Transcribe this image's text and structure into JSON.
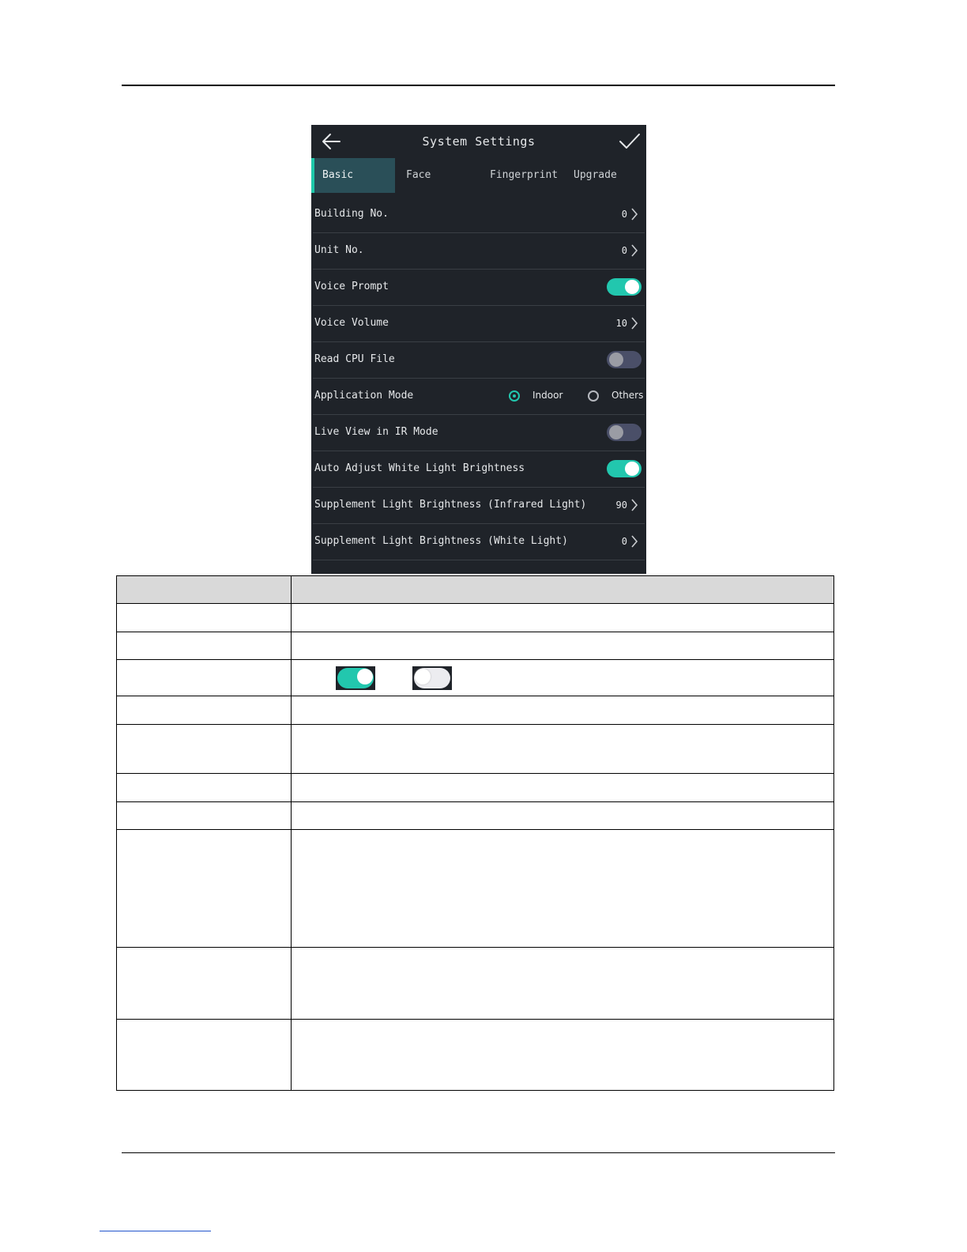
{
  "device_screen": {
    "title": "System Settings",
    "icons": {
      "back": "arrow-left-icon",
      "confirm": "checkmark-icon",
      "row_arrow": "chevron-right-icon"
    },
    "colors": {
      "background": "#1f2329",
      "accent": "#22c7ae",
      "active_tab": "#2a4f58",
      "toggle_off": "#4a4f68"
    },
    "tabs": [
      {
        "label": "Basic",
        "active": true
      },
      {
        "label": "Face",
        "active": false
      },
      {
        "label": "Fingerprint",
        "active": false
      },
      {
        "label": "Upgrade",
        "active": false
      }
    ],
    "rows": {
      "building_no": {
        "label": "Building No.",
        "value": "0"
      },
      "unit_no": {
        "label": "Unit No.",
        "value": "0"
      },
      "voice_prompt": {
        "label": "Voice Prompt",
        "enabled": true
      },
      "voice_volume": {
        "label": "Voice Volume",
        "value": "10"
      },
      "read_cpu_file": {
        "label": "Read CPU File",
        "enabled": false
      },
      "application_mode": {
        "label": "Application Mode",
        "options": [
          "Indoor",
          "Others"
        ],
        "selected": "Indoor"
      },
      "live_view_ir": {
        "label": "Live View in IR Mode",
        "enabled": false
      },
      "auto_adjust_white": {
        "label": "Auto Adjust White Light Brightness",
        "enabled": true
      },
      "supplement_ir": {
        "label": "Supplement Light Brightness (Infrared Light)",
        "value": "90"
      },
      "supplement_white": {
        "label": "Supplement Light Brightness (White Light)",
        "value": "0"
      }
    }
  },
  "table_icons": {
    "enabled_toggle": "toggle-on-icon",
    "disabled_toggle": "toggle-off-icon"
  }
}
